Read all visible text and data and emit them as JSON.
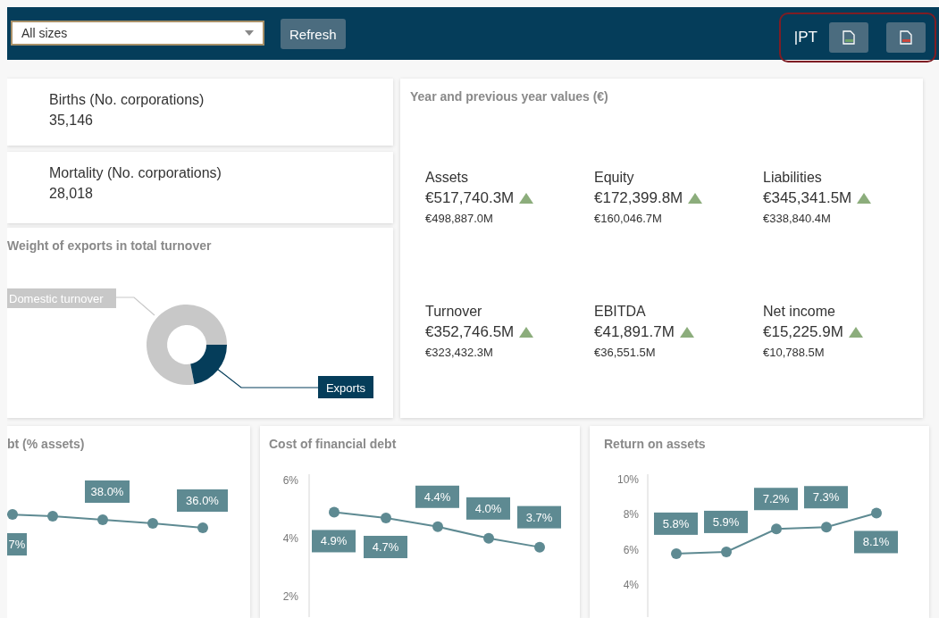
{
  "toolbar": {
    "size_filter": {
      "value": "All sizes"
    },
    "refresh_button": "Refresh",
    "language": "|PT",
    "export_group": {
      "highlighted": true
    }
  },
  "kpis": [
    {
      "label": "Births (No. corporations)",
      "value": "35,146"
    },
    {
      "label": "Mortality (No. corporations)",
      "value": "28,018"
    }
  ],
  "donut": {
    "title": "Weight of exports in total turnover",
    "segments": [
      {
        "label": "Domestic turnover",
        "color": "#c8c8c8"
      },
      {
        "label": "Exports",
        "color": "#053d5a"
      }
    ]
  },
  "year_values": {
    "title": "Year and previous year values (€)",
    "metrics": [
      {
        "label": "Assets",
        "value": "€517,740.3M",
        "increased": true,
        "previous": "€498,887.0M"
      },
      {
        "label": "Equity",
        "value": "€172,399.8M",
        "increased": true,
        "previous": "€160,046.7M"
      },
      {
        "label": "Liabilities",
        "value": "€345,341.5M",
        "increased": true,
        "previous": "€338,840.4M"
      },
      {
        "label": "Turnover",
        "value": "€352,746.5M",
        "increased": true,
        "previous": "€323,432.3M"
      },
      {
        "label": "EBITDA",
        "value": "€41,891.7M",
        "increased": true,
        "previous": "€36,551.5M"
      },
      {
        "label": "Net income",
        "value": "€15,225.9M",
        "increased": true,
        "previous": "€10,788.5M"
      }
    ]
  },
  "line_cards": [
    {
      "title": "bt (% assets)",
      "labels": [
        "7%",
        "38.0%",
        "36.0%"
      ]
    },
    {
      "title": "Cost of financial debt",
      "chart_data": {
        "type": "line",
        "categories": [
          null,
          null,
          null,
          null,
          null
        ],
        "series": [
          {
            "color": "#5e8a92",
            "marker": "circle",
            "values": [
              4.9,
              4.7,
              4.4,
              4.0,
              3.7
            ]
          }
        ],
        "ylim": [
          1.3,
          6.2
        ],
        "yticks": [
          {
            "value": 2,
            "label": "2%"
          },
          {
            "value": 4,
            "label": "4%"
          },
          {
            "value": 6,
            "label": "6%"
          }
        ],
        "value_labels": [
          "4.9%",
          "4.7%",
          "4.4%",
          "4.0%",
          "3.7%"
        ]
      }
    },
    {
      "title": "Return on assets",
      "chart_data": {
        "type": "line",
        "categories": [
          null,
          null,
          null,
          null,
          null
        ],
        "series": [
          {
            "color": "#5e8a92",
            "marker": "circle",
            "values": [
              5.8,
              5.9,
              7.2,
              7.3,
              8.1
            ]
          }
        ],
        "ylim": [
          2.2,
          10.3
        ],
        "yticks": [
          {
            "value": 4,
            "label": "4%"
          },
          {
            "value": 6,
            "label": "6%"
          },
          {
            "value": 8,
            "label": "8%"
          },
          {
            "value": 10,
            "label": "10%"
          }
        ],
        "value_labels": [
          "5.8%",
          "5.9%",
          "7.2%",
          "7.3%",
          "8.1%"
        ]
      }
    }
  ]
}
